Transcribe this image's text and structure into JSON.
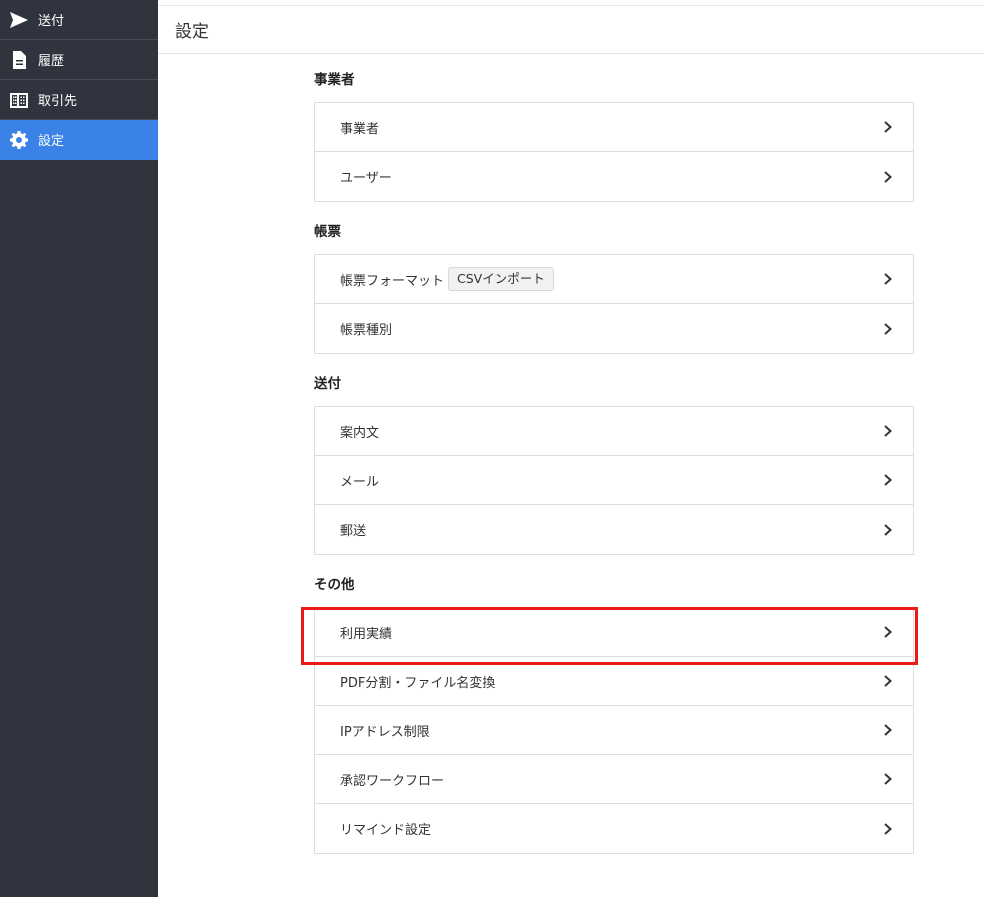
{
  "sidebar": {
    "items": [
      {
        "label": "送付",
        "icon": "send-icon"
      },
      {
        "label": "履歴",
        "icon": "document-icon"
      },
      {
        "label": "取引先",
        "icon": "building-icon"
      },
      {
        "label": "設定",
        "icon": "gear-icon",
        "active": true
      }
    ]
  },
  "header": {
    "title": "設定"
  },
  "sections": {
    "business": {
      "heading": "事業者",
      "items": [
        "事業者",
        "ユーザー"
      ]
    },
    "forms": {
      "heading": "帳票",
      "items": [
        "帳票フォーマット",
        "帳票種別"
      ],
      "badge": "CSVインポート"
    },
    "delivery": {
      "heading": "送付",
      "items": [
        "案内文",
        "メール",
        "郵送"
      ]
    },
    "other": {
      "heading": "その他",
      "items": [
        "利用実績",
        "PDF分割・ファイル名変換",
        "IPアドレス制限",
        "承認ワークフロー",
        "リマインド設定"
      ]
    }
  },
  "colors": {
    "sidebar_bg": "#30343e",
    "active": "#3a82e6",
    "highlight": "#e81b1b"
  }
}
